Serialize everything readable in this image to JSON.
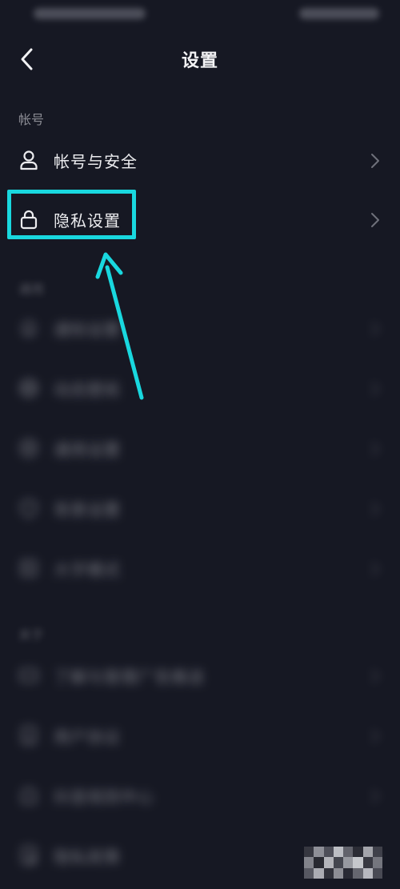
{
  "header": {
    "title": "设置"
  },
  "sections": {
    "account": {
      "label": "帐号"
    },
    "general": {
      "label": "通用"
    },
    "about": {
      "label": "关于"
    }
  },
  "rows": {
    "account_security": {
      "label": "帐号与安全",
      "icon": "user-icon"
    },
    "privacy": {
      "label": "隐私设置",
      "icon": "lock-icon"
    },
    "notifications": {
      "label": "通知设置",
      "icon": "bell-icon"
    },
    "feed_settings": {
      "label": "动态壁纸",
      "icon": "circle-icon"
    },
    "general_settings": {
      "label": "通用设置",
      "icon": "gear-icon"
    },
    "background_settings": {
      "label": "背景设置",
      "icon": "shield-icon"
    },
    "elder_mode": {
      "label": "大字模式",
      "icon": "book-icon"
    },
    "ads_manage": {
      "label": "了解与管理广告推送",
      "icon": "ad-icon"
    },
    "user_agreement": {
      "label": "用户协议",
      "icon": "document-icon"
    },
    "rules_center": {
      "label": "抖音规则中心",
      "icon": "rules-icon"
    },
    "privacy_policy": {
      "label": "隐私政策",
      "icon": "policy-icon"
    }
  },
  "colors": {
    "background": "#161823",
    "highlight": "#19d8df",
    "text": "#ececef",
    "muted": "#8a8b93"
  }
}
